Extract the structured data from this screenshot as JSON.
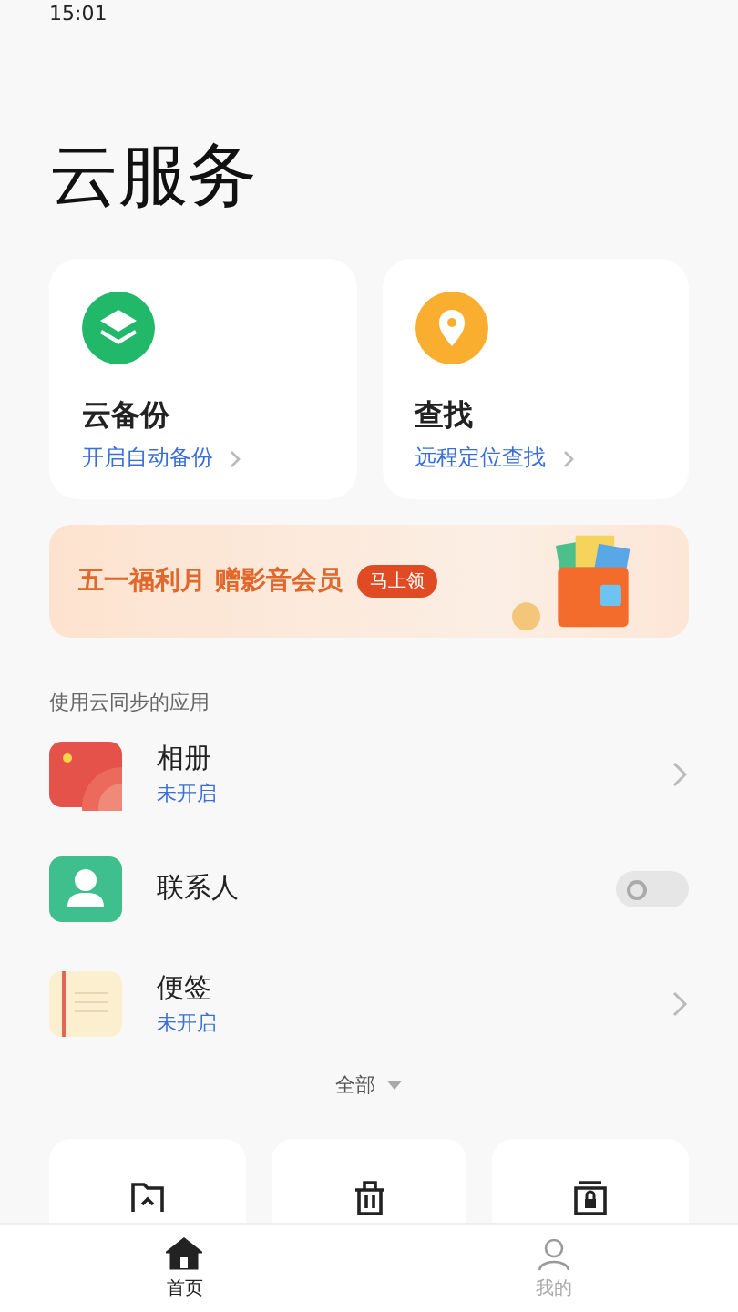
{
  "status_bar": {
    "time": "15:01"
  },
  "title": "云服务",
  "feature_cards": [
    {
      "kind": "backup",
      "title": "云备份",
      "link": "开启自动备份"
    },
    {
      "kind": "find",
      "title": "查找",
      "link": "远程定位查找"
    }
  ],
  "banner": {
    "text": "五一福利月 赠影音会员",
    "button": "马上领"
  },
  "section_label": "使用云同步的应用",
  "apps": [
    {
      "kind": "link",
      "name": "相册",
      "status": "未开启"
    },
    {
      "kind": "toggle",
      "name": "联系人",
      "on": false
    },
    {
      "kind": "link",
      "name": "便签",
      "status": "未开启"
    }
  ],
  "expand_label": "全部",
  "tabs": [
    {
      "label": "首页",
      "selected": true
    },
    {
      "label": "我的",
      "selected": false
    }
  ]
}
